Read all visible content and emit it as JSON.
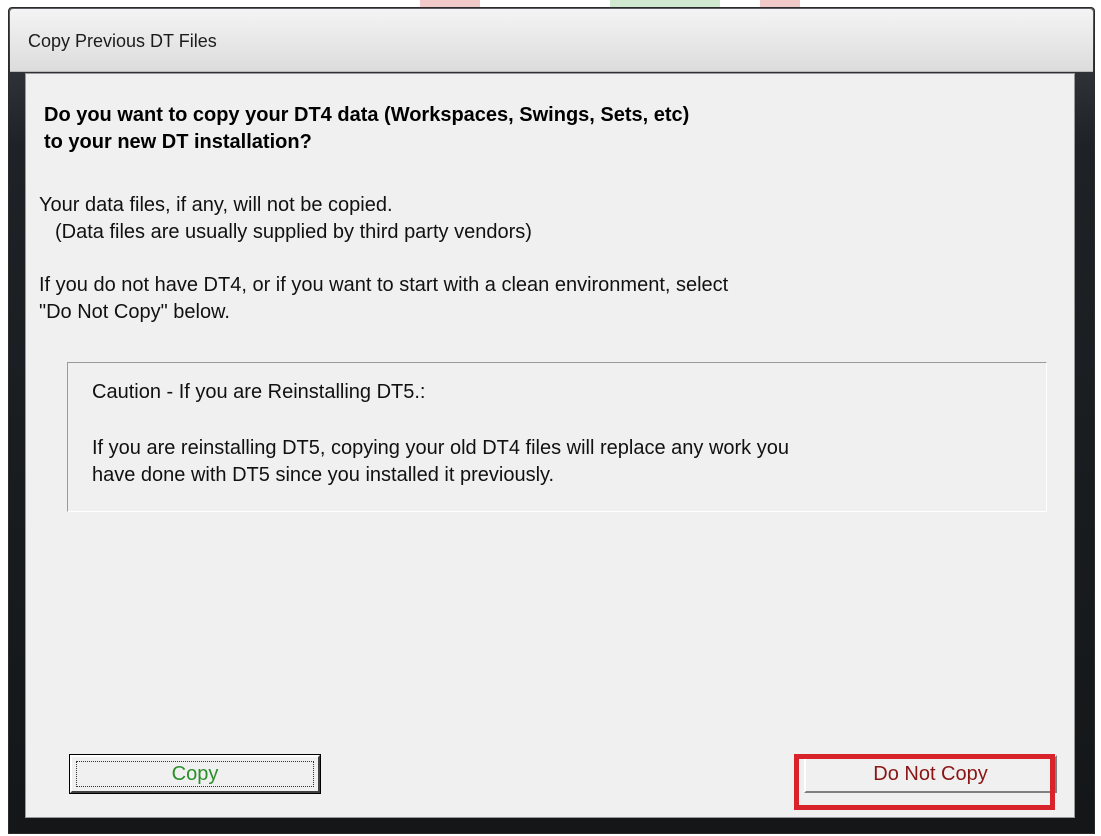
{
  "window": {
    "title": "Copy Previous DT Files"
  },
  "dialog": {
    "question_line1": "Do you want to copy your DT4 data  (Workspaces, Swings, Sets, etc)",
    "question_line2": "to your new DT installation?",
    "info1_line1": "Your data files, if any, will not be copied.",
    "info1_line2": "(Data files are usually supplied by third party vendors)",
    "info2_line1": "If you do not have DT4, or if you want to start with a clean environment, select",
    "info2_line2": "\"Do Not Copy\" below.",
    "caution_title": "Caution - If you are Reinstalling DT5.:",
    "caution_line1": "If you are reinstalling DT5, copying your old DT4 files will replace any work you",
    "caution_line2": "have done with DT5 since you installed it previously."
  },
  "buttons": {
    "copy_label": "Copy",
    "do_not_copy_label": "Do Not Copy"
  },
  "colors": {
    "copy_text": "#2a8f2a",
    "do_not_copy_text": "#8a1515",
    "highlight_border": "#d8232a",
    "dialog_background": "#f0f0f0"
  }
}
